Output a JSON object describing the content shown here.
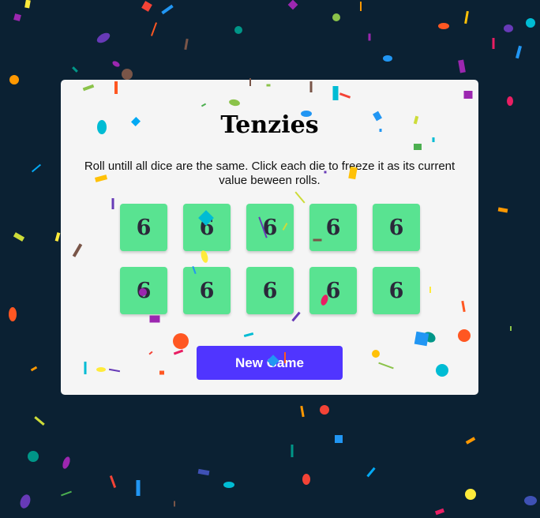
{
  "game": {
    "title": "Tenzies",
    "instructions": "Roll untill all dice are the same. Click each die to freeze it as its current value beween rolls.",
    "dice": [
      "6",
      "6",
      "6",
      "6",
      "6",
      "6",
      "6",
      "6",
      "6",
      "6"
    ],
    "button_label": "New Game"
  },
  "colors": {
    "background": "#0b2133",
    "card": "#f5f5f5",
    "die_held": "#59e391",
    "die_text": "#2b283a",
    "button": "#5035ff",
    "confetti": [
      "#f44336",
      "#e91e63",
      "#9c27b0",
      "#673ab7",
      "#3f51b5",
      "#2196f3",
      "#03a9f4",
      "#00bcd4",
      "#009688",
      "#4caf50",
      "#8bc34a",
      "#cddc39",
      "#ffeb3b",
      "#ffc107",
      "#ff9800",
      "#ff5722",
      "#795548"
    ]
  }
}
